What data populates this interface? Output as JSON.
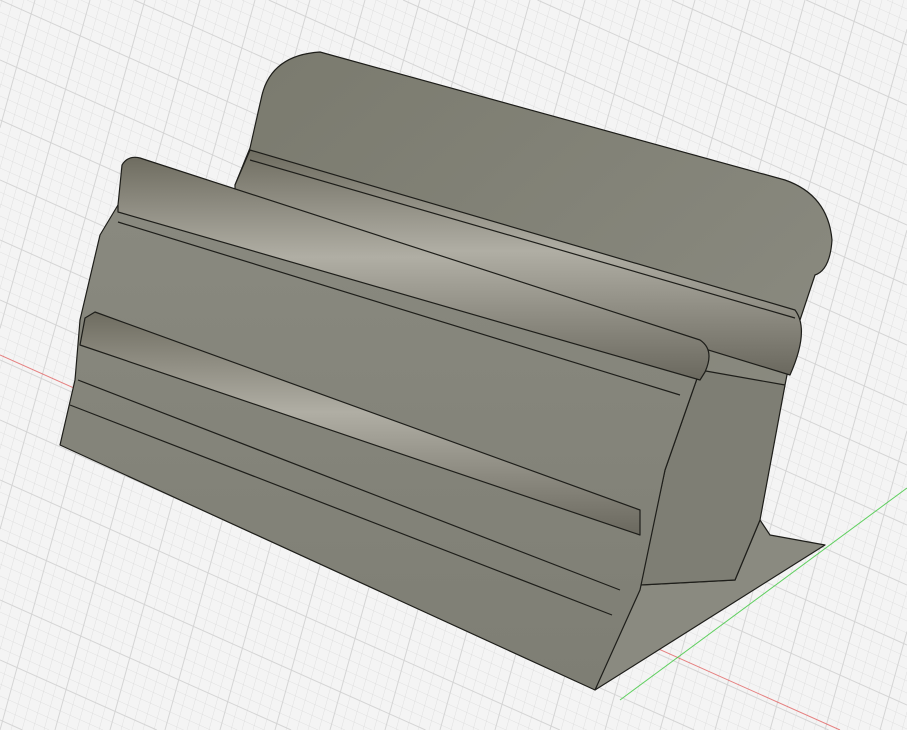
{
  "viewport": {
    "background": "#f4f4f4",
    "grid_color": "#d2d2d2",
    "x_axis_color": "#e05050",
    "y_axis_color": "#3cc83c"
  },
  "model": {
    "body_color": "#858578",
    "edge_color": "#1e1e1a"
  }
}
